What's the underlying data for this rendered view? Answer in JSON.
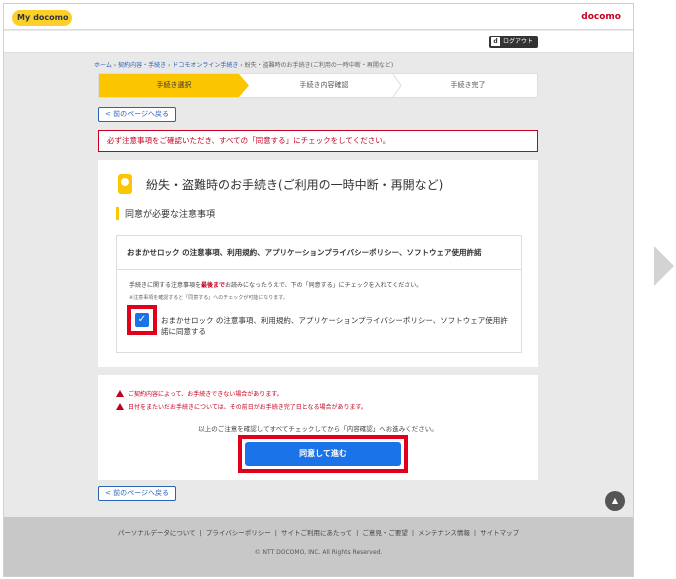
{
  "header": {
    "logo_my": "My",
    "logo_docomo": "docomo",
    "brand": "docomo"
  },
  "logout": {
    "d": "d",
    "label": "ログアウト"
  },
  "breadcrumb": [
    "ホーム",
    "契約内容・手続き",
    "ドコモオンライン手続き",
    "紛失・盗難時のお手続き(ご利用の一時中断・再開など)"
  ],
  "steps": [
    "手続き選択",
    "手続き内容確認",
    "手続き完了"
  ],
  "back_label": "< 前のページへ戻る",
  "alert": "必ず注意事項をご確認いただき、すべての「同意する」にチェックをしてください。",
  "card": {
    "title": "紛失・盗難時のお手続き(ご利用の一時中断・再開など)",
    "section": "同意が必要な注意事項",
    "terms_head": "おまかせロック の注意事項、利用規約、アプリケーションプライバシーポリシー、ソフトウェア使用許諾",
    "note1_pre": "手続きに関する注意事項を",
    "note1_em": "最後まで",
    "note1_post": "お読みになったうえで、下の「同意する」にチェックを入れてください。",
    "note2": "※注意事項を確認すると「同意する」へのチェックが可能になります。",
    "checkbox_checked": true,
    "check_label": "おまかせロック の注意事項、利用規約、アプリケーションプライバシーポリシー、ソフトウェア使用許諾に同意する"
  },
  "warnings": [
    "ご契約内容によって、お手続きできない場合があります。",
    "日付をまたいだお手続きについては、その前日がお手続き完了日となる場合があります。"
  ],
  "confirm_note": "以上のご注意を確認してすべてチェックしてから「内容確認」へお進みください。",
  "proceed_label": "同意して進む",
  "scroll_top": "▲",
  "footer": {
    "links": [
      "パーソナルデータについて",
      "プライバシーポリシー",
      "サイトご利用にあたって",
      "ご意見・ご要望",
      "メンテナンス情報",
      "サイトマップ"
    ],
    "copyright": "© NTT DOCOMO, INC. All Rights Reserved."
  },
  "colors": {
    "accent_yellow": "#fbc500",
    "docomo_red": "#c4001f",
    "button_blue": "#1a73e8",
    "highlight_red": "#e0001b"
  }
}
